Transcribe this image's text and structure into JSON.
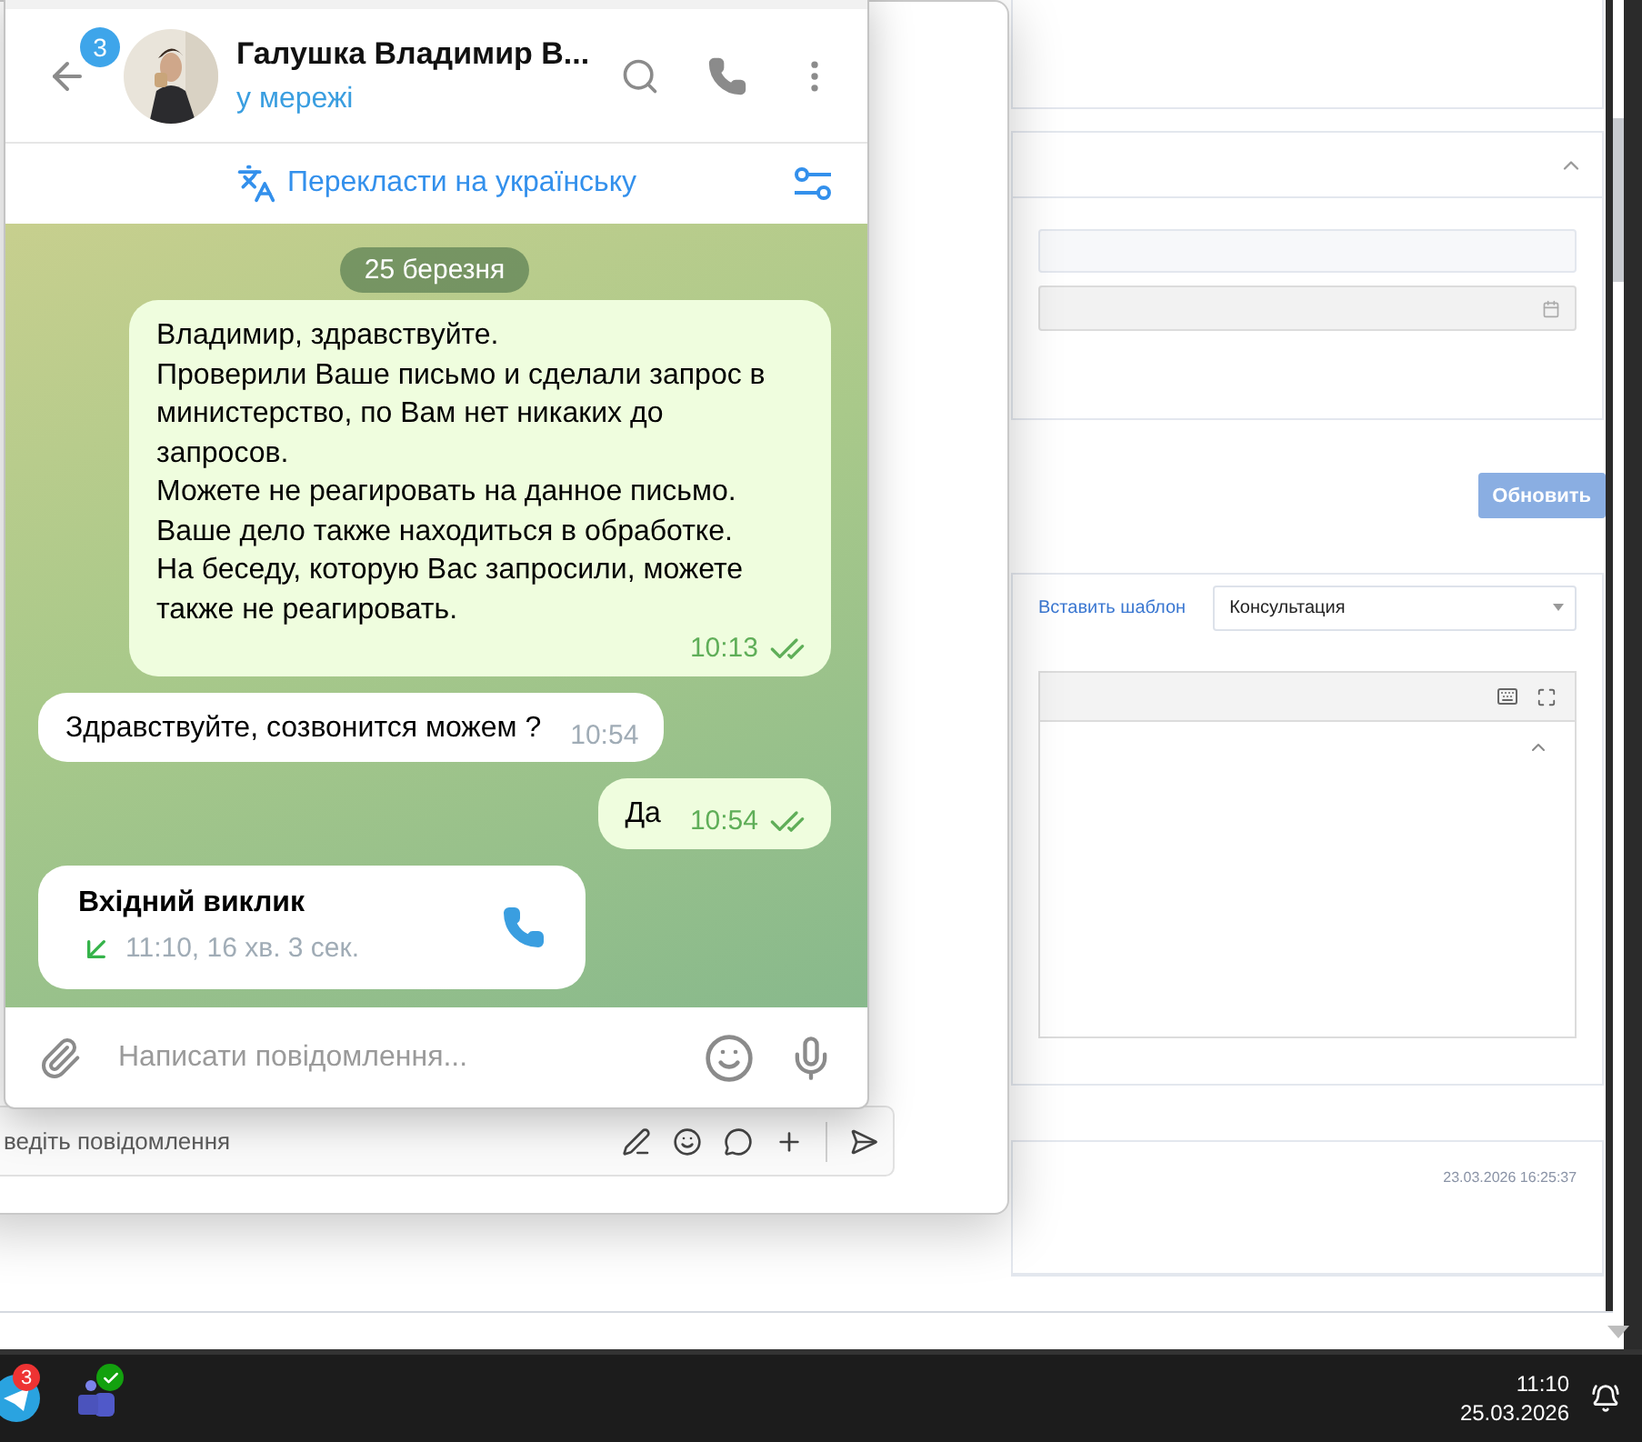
{
  "web_app": {
    "accordion_expanded": true,
    "update_button": "Обновить",
    "insert_template_link": "Вставить шаблон",
    "template_select": "Консультация",
    "history": [
      {
        "timestamp": "23.03.2026 16:25:37"
      }
    ]
  },
  "teams_window": {
    "compose_placeholder": "ведіть повідомлення"
  },
  "telegram": {
    "unread_badge": "3",
    "contact_name": "Галушка Владимир В...",
    "status": "у мережі",
    "translate_label": "Перекласти на українську",
    "date_label": "25 березня",
    "messages": [
      {
        "kind": "text",
        "outgoing": true,
        "text": "Владимир, здравствуйте.\nПроверили Ваше письмо и сделали запрос в министерство, по Вам нет никаких до запросов.\nМожете не реагировать на данное письмо.\nВаше дело также находиться в обработке.\nНа беседу, которую Вас запросили, можете также не реагировать.",
        "time": "10:13",
        "read": true
      },
      {
        "kind": "text",
        "outgoing": false,
        "text": "Здравствуйте, созвонится можем ?",
        "time": "10:54"
      },
      {
        "kind": "text",
        "outgoing": true,
        "text": "Да",
        "time": "10:54",
        "read": true
      },
      {
        "kind": "call",
        "outgoing": false,
        "title": "Вхідний виклик",
        "detail": "11:10, 16 хв. 3 сек."
      }
    ],
    "composer_placeholder": "Написати повідомлення..."
  },
  "taskbar": {
    "apps": [
      {
        "kind": "telegram",
        "badge": "3"
      },
      {
        "kind": "teams",
        "available": true
      }
    ],
    "time": "11:10",
    "date": "25.03.2026"
  }
}
